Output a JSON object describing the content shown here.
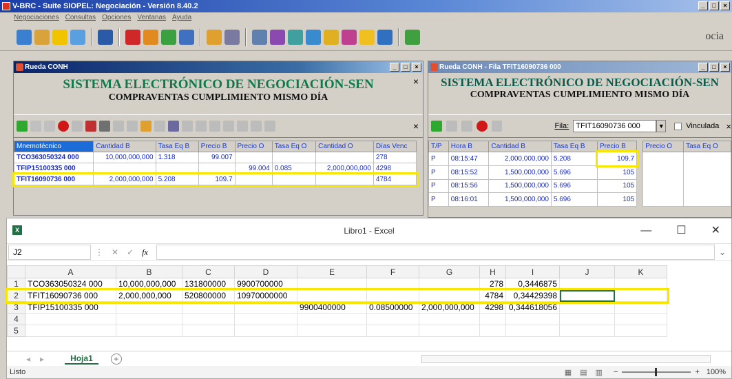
{
  "app": {
    "title": "V-BRC - Suite SIOPEL: Negociación - Versión 8.40.2",
    "menu": [
      "Negociaciones",
      "Consultas",
      "Opciones",
      "Ventanas",
      "Ayuda"
    ],
    "corner_text": "ocia"
  },
  "win1": {
    "title": "Rueda CONH",
    "heading1": "SISTEMA ELECTRÓNICO DE NEGOCIACIÓN-SEN",
    "heading2": "COMPRAVENTAS CUMPLIMIENTO MISMO DÍA",
    "columns": [
      "Mnemotécnico",
      "Cantidad B",
      "Tasa Eq B",
      "Precio B",
      "Precio O",
      "Tasa Eq O",
      "Cantidad O",
      "Días Venc"
    ],
    "rows": [
      [
        "TCO363050324 000",
        "10,000,000,000",
        "1.318",
        "99.007",
        "",
        "",
        "",
        "278"
      ],
      [
        "TFIP15100335 000",
        "",
        "",
        "",
        "99.004",
        "0.085",
        "2,000,000,000",
        "4298"
      ],
      [
        "TFIT16090736 000",
        "2,000,000,000",
        "5.208",
        "109.7",
        "",
        "",
        "",
        "4784"
      ]
    ]
  },
  "win2": {
    "title": "Rueda CONH - Fila TFIT16090736 000",
    "heading1": "SISTEMA ELECTRÓNICO DE NEGOCIACIÓN-SEN",
    "heading2": "COMPRAVENTAS CUMPLIMIENTO MISMO DÍA",
    "fila_label": "Fila:",
    "fila_value": "TFIT16090736 000",
    "vinculada_label": "Vinculada",
    "columns": [
      "T/P",
      "Hora B",
      "Cantidad B",
      "Tasa Eq B",
      "Precio B",
      "Precio O",
      "Tasa Eq O"
    ],
    "rows": [
      [
        "P",
        "08:15:47",
        "2,000,000,000",
        "5.208",
        "109.7"
      ],
      [
        "P",
        "08:15:52",
        "1,500,000,000",
        "5.696",
        "105"
      ],
      [
        "P",
        "08:15:56",
        "1,500,000,000",
        "5.696",
        "105"
      ],
      [
        "P",
        "08:16:01",
        "1,500,000,000",
        "5.696",
        "105"
      ]
    ]
  },
  "excel": {
    "title": "Libro1 - Excel",
    "name_box": "J2",
    "fx": "fx",
    "columns": [
      "A",
      "B",
      "C",
      "D",
      "E",
      "F",
      "G",
      "H",
      "I",
      "J",
      "K"
    ],
    "rows": [
      [
        "TCO363050324 000",
        "10,000,000,000",
        "131800000",
        "9900700000",
        "",
        "",
        "",
        "278",
        "0,3446875",
        "",
        ""
      ],
      [
        "TFIT16090736 000",
        "2,000,000,000",
        "520800000",
        "10970000000",
        "",
        "",
        "",
        "4784",
        "0,34429398",
        "",
        ""
      ],
      [
        "TFIP15100335 000",
        "",
        "",
        "",
        "9900400000",
        "0.08500000",
        "2,000,000,000",
        "4298",
        "0,344618056",
        "",
        ""
      ],
      [
        "",
        "",
        "",
        "",
        "",
        "",
        "",
        "",
        "",
        "",
        ""
      ],
      [
        "",
        "",
        "",
        "",
        "",
        "",
        "",
        "",
        "",
        "",
        ""
      ]
    ],
    "row_numbers": [
      "1",
      "2",
      "3",
      "4",
      "5"
    ],
    "sheet_tab": "Hoja1",
    "status": "Listo",
    "zoom": "100%"
  }
}
